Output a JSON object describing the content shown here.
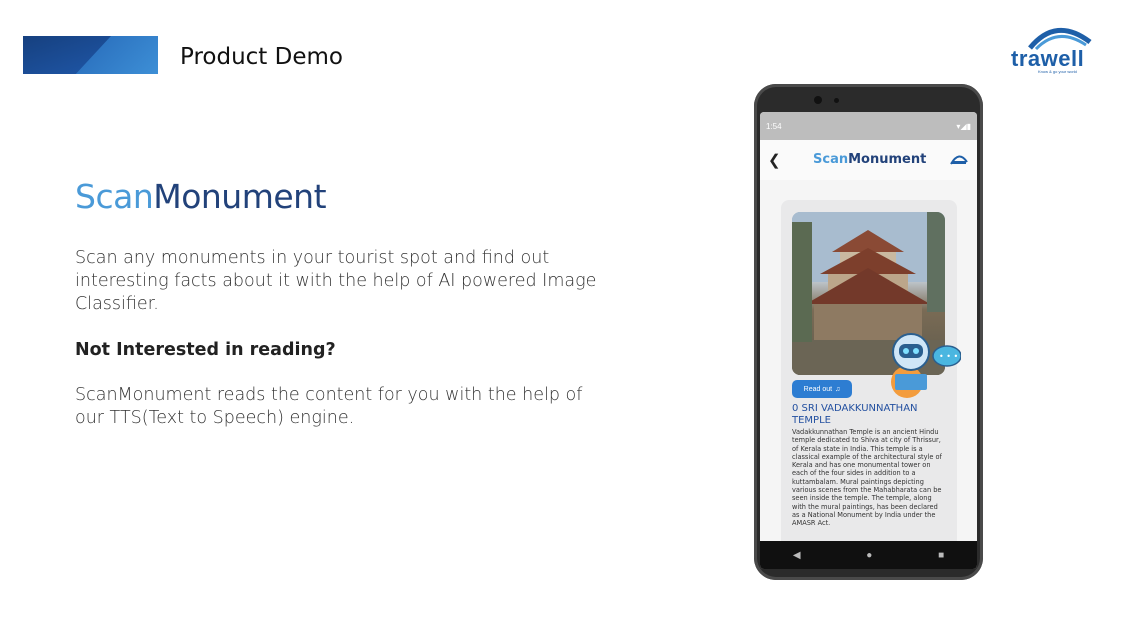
{
  "header": {
    "title": "Product Demo"
  },
  "logo": {
    "text": "trawell",
    "tagline": "Know & go your world"
  },
  "feature": {
    "title_part1": "Scan",
    "title_part2": "Monument",
    "paragraph1": "Scan any monuments in your tourist spot and find out interesting facts about it with the help of AI powered Image Classifier.",
    "paragraph2": "Not Interested in reading?",
    "paragraph3": "ScanMonument reads the content for you with the help of our TTS(Text to Speech) engine."
  },
  "phone": {
    "status_time": "1:54",
    "app_title_part1": "Scan",
    "app_title_part2": "Monument",
    "read_button": "Read out",
    "place_title": "0 SRI VADAKKUNNATHAN TEMPLE",
    "place_description": "Vadakkunnathan Temple is an ancient Hindu temple dedicated to Shiva at city of Thrissur, of Kerala state in India. This temple is a classical example of the architectural style of Kerala and has one monumental tower on each of the four sides in addition to a kuttambalam. Mural paintings depicting various scenes from the Mahabharata can be seen inside the temple. The temple, along with the mural paintings, has been declared as a National Monument by India under the AMASR Act.",
    "nav_icons": [
      "back-triangle-icon",
      "home-circle-icon",
      "recents-square-icon"
    ]
  },
  "colors": {
    "accent_light": "#4a9ad8",
    "accent_dark": "#22427a",
    "button": "#2d7dd2"
  }
}
